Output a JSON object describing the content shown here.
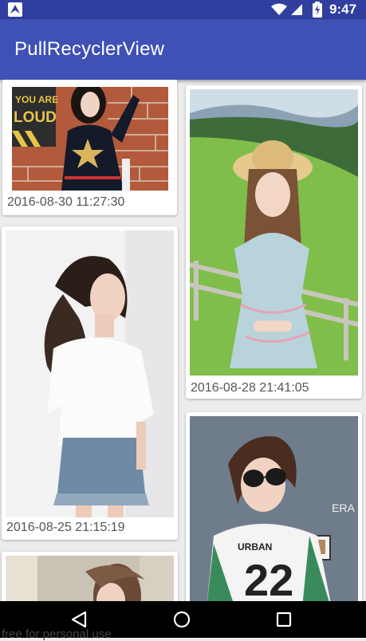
{
  "status_bar": {
    "time": "9:47",
    "icons": [
      "app-notification-icon",
      "wifi-icon",
      "signal-icon",
      "battery-charging-icon"
    ]
  },
  "app_bar": {
    "title": "PullRecyclerView"
  },
  "feed": {
    "items": [
      {
        "date": "2016-08-30 11:27:30",
        "photo_text": "YOU ARE LOUD"
      },
      {
        "date": "2016-08-28 21:41:05"
      },
      {
        "date": "2016-08-25 21:15:19"
      },
      {
        "date": ""
      },
      {
        "date": "",
        "photo_text": "URBAN"
      }
    ]
  },
  "nav_bar": {
    "buttons": [
      "back",
      "home",
      "recents"
    ]
  },
  "watermark": "free for personal use",
  "colors": {
    "primary": "#3F51B5",
    "primary_dark": "#303F9F",
    "caption": "#555555"
  }
}
